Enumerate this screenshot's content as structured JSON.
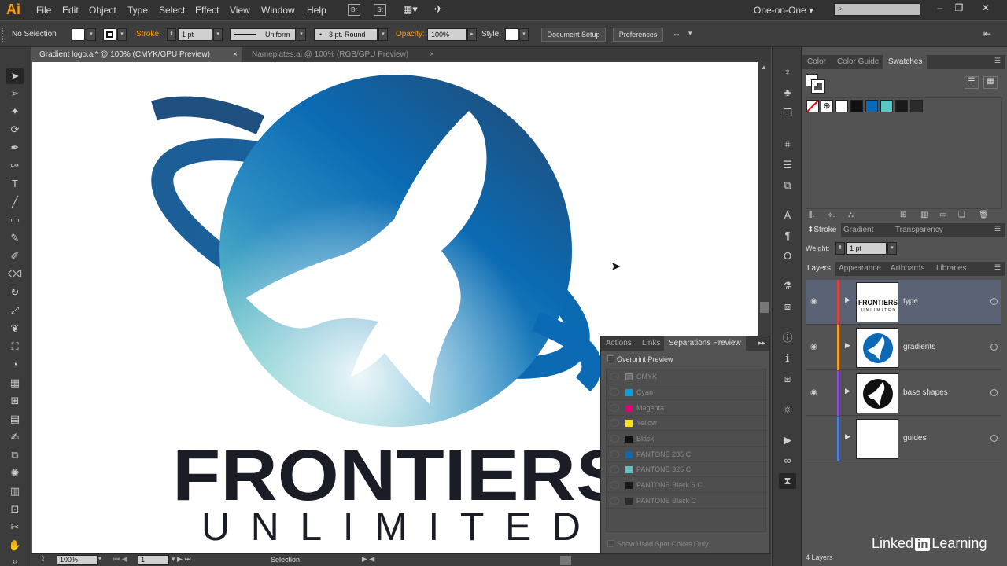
{
  "app": {
    "logo": "Ai",
    "menus": [
      "File",
      "Edit",
      "Object",
      "Type",
      "Select",
      "Effect",
      "View",
      "Window",
      "Help"
    ],
    "bridge_label": "Br",
    "stock_label": "St",
    "workspace": "One-on-One"
  },
  "control_bar": {
    "selection_state": "No Selection",
    "stroke_label": "Stroke:",
    "stroke_weight": "1 pt",
    "stroke_profile": "Uniform",
    "brush": "3 pt. Round",
    "opacity_label": "Opacity:",
    "opacity_value": "100%",
    "style_label": "Style:",
    "document_setup": "Document Setup",
    "preferences": "Preferences"
  },
  "doc_tabs": [
    {
      "label": "Gradient logo.ai* @ 100% (CMYK/GPU Preview)",
      "active": true
    },
    {
      "label": "Nameplates.ai @ 100% (RGB/GPU Preview)",
      "active": false
    }
  ],
  "artwork": {
    "title_line": "FRONTIERS",
    "subtitle_line": "UNLIMITED"
  },
  "status_bar": {
    "zoom": "100%",
    "artboard": "1",
    "tool": "Selection"
  },
  "separations_panel": {
    "tabs": [
      "Actions",
      "Links",
      "Separations Preview"
    ],
    "active_tab": "Separations Preview",
    "overprint_label": "Overprint Preview",
    "plates": [
      {
        "name": "CMYK",
        "color": "#6b6b6b"
      },
      {
        "name": "Cyan",
        "color": "#00a3e0"
      },
      {
        "name": "Magenta",
        "color": "#e0007a"
      },
      {
        "name": "Yellow",
        "color": "#ffe600"
      },
      {
        "name": "Black",
        "color": "#111111"
      },
      {
        "name": "PANTONE 285 C",
        "color": "#0b6ab3"
      },
      {
        "name": "PANTONE 325 C",
        "color": "#5ec6c2"
      },
      {
        "name": "PANTONE Black 6 C",
        "color": "#1a1a1a"
      },
      {
        "name": "PANTONE Black C",
        "color": "#2b2b2b"
      }
    ],
    "spot_only_label": "Show Used Spot Colors Only"
  },
  "swatches_panel": {
    "tabs": [
      "Color",
      "Color Guide",
      "Swatches"
    ],
    "active_tab": "Swatches",
    "swatch_colors": [
      "#ffffff",
      "#111111",
      "#0b6ab3",
      "#5ec6c2",
      "#1a1a1a",
      "#2b2b2b"
    ]
  },
  "stroke_panel": {
    "tabs": [
      "Stroke",
      "Gradient",
      "Transparency"
    ],
    "active_tab": "Stroke",
    "weight_label": "Weight:",
    "weight_value": "1 pt"
  },
  "layers_panel": {
    "tabs": [
      "Layers",
      "Appearance",
      "Artboards",
      "Libraries"
    ],
    "active_tab": "Layers",
    "layers": [
      {
        "name": "type",
        "color": "#e0403c",
        "selected": true
      },
      {
        "name": "gradients",
        "color": "#ff9a1a",
        "selected": false
      },
      {
        "name": "base shapes",
        "color": "#8a4fd8",
        "selected": false
      },
      {
        "name": "guides",
        "color": "#4a7fe0",
        "selected": false
      }
    ],
    "footer": "4 Layers"
  },
  "watermark": {
    "pre": "Linked",
    "in": "in",
    "post": "Learning"
  }
}
